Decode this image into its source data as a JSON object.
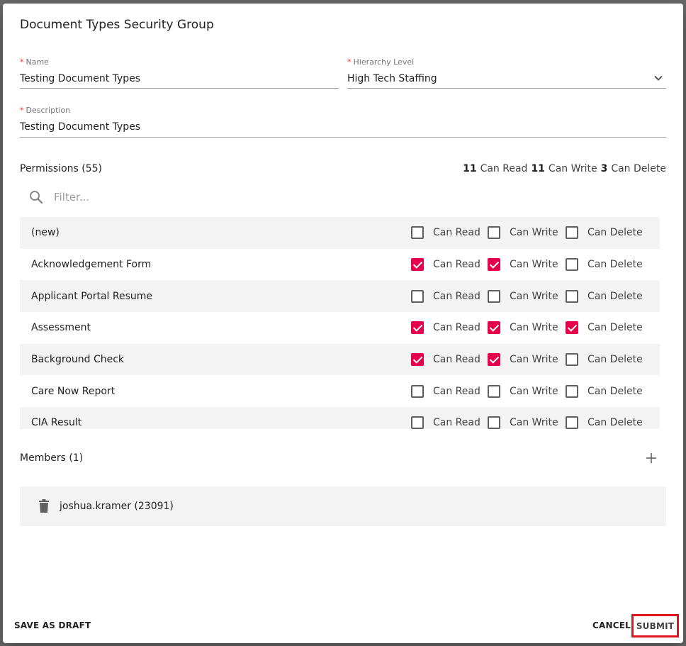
{
  "dialog": {
    "title": "Document Types Security Group"
  },
  "fields": {
    "name": {
      "required_mark": "*",
      "label": "Name",
      "value": "Testing Document Types"
    },
    "hierarchy": {
      "required_mark": "*",
      "label": "Hierarchy Level",
      "value": "High Tech Staffing"
    },
    "description": {
      "required_mark": "*",
      "label": "Description",
      "value": "Testing Document Types"
    }
  },
  "permissions": {
    "title": "Permissions (55)",
    "summary": {
      "read_count": "11",
      "read_label": "Can Read",
      "write_count": "11",
      "write_label": "Can Write",
      "delete_count": "3",
      "delete_label": "Can Delete"
    },
    "filter_placeholder": "Filter...",
    "labels": {
      "read": "Can Read",
      "write": "Can Write",
      "delete": "Can Delete"
    },
    "rows": [
      {
        "name": "(new)",
        "read": false,
        "write": false,
        "delete": false
      },
      {
        "name": "Acknowledgement Form",
        "read": true,
        "write": true,
        "delete": false
      },
      {
        "name": "Applicant Portal Resume",
        "read": false,
        "write": false,
        "delete": false
      },
      {
        "name": "Assessment",
        "read": true,
        "write": true,
        "delete": true
      },
      {
        "name": "Background Check",
        "read": true,
        "write": true,
        "delete": false
      },
      {
        "name": "Care Now Report",
        "read": false,
        "write": false,
        "delete": false
      },
      {
        "name": "CIA Result",
        "read": false,
        "write": false,
        "delete": false
      }
    ]
  },
  "members": {
    "title": "Members (1)",
    "items": [
      {
        "name": "joshua.kramer (23091)"
      }
    ]
  },
  "footer": {
    "save_draft": "SAVE AS DRAFT",
    "cancel": "CANCEL",
    "submit": "SUBMIT"
  },
  "colors": {
    "accent": "#e5004c",
    "highlight_border": "#e0141e",
    "row_stripe": "#f3f3f3"
  },
  "icons": {
    "chevron": "chevron-down-icon",
    "search": "search-icon",
    "add": "plus-icon",
    "trash": "trash-icon"
  }
}
